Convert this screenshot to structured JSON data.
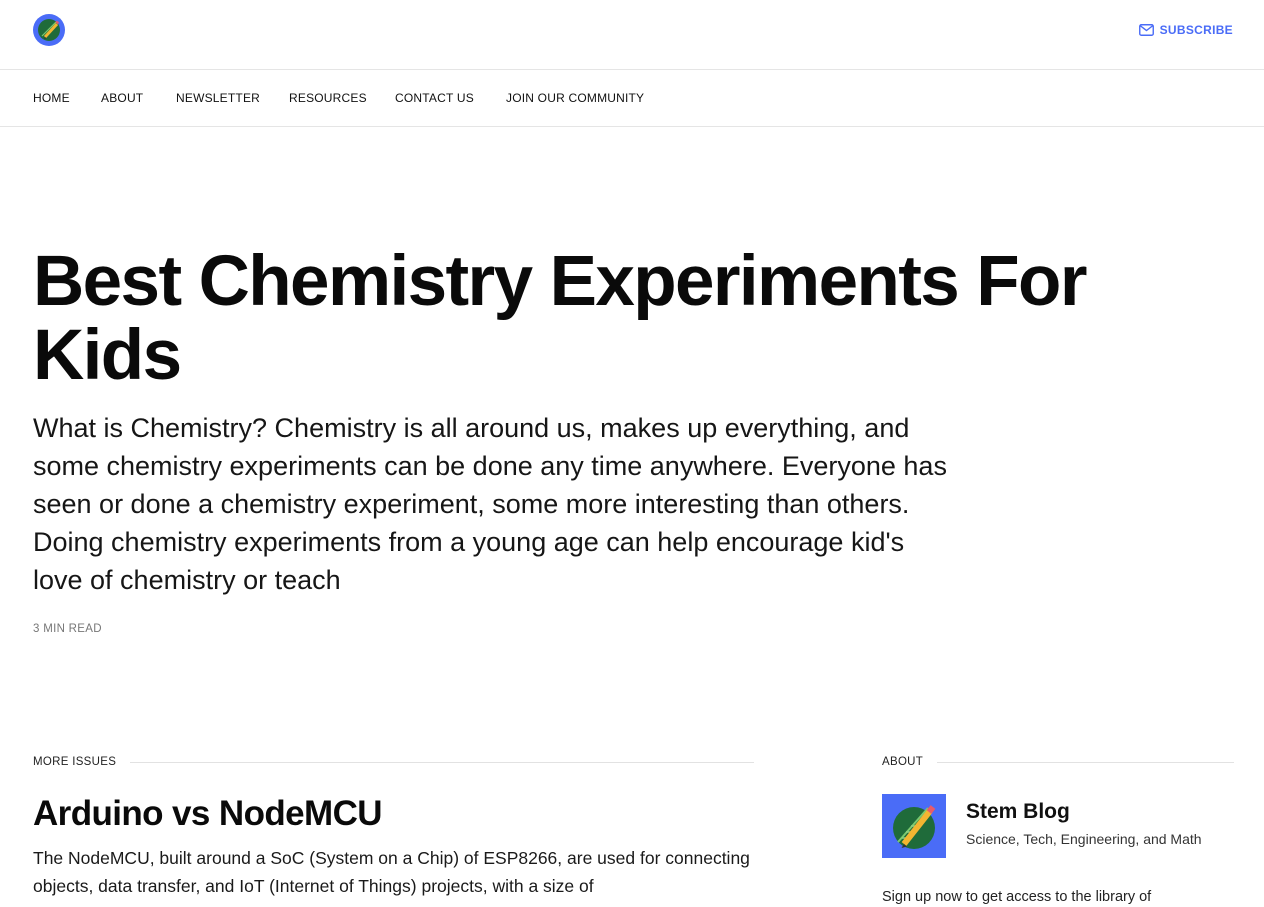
{
  "header": {
    "subscribe_label": "SUBSCRIBE"
  },
  "nav": {
    "items": [
      "HOME",
      "ABOUT",
      "NEWSLETTER",
      "RESOURCES",
      "CONTACT US",
      "JOIN OUR COMMUNITY"
    ]
  },
  "hero": {
    "title": "Best Chemistry Experiments For Kids",
    "excerpt": "What is Chemistry? Chemistry is all around us, makes up everything, and some chemistry experiments can be done any time anywhere. Everyone has seen or done a chemistry experiment, some more interesting than others. Doing chemistry experiments from a young age can help encourage kid's love of chemistry or teach",
    "read_time": "3 MIN READ"
  },
  "more_issues": {
    "heading": "MORE ISSUES",
    "title": "Arduino vs NodeMCU",
    "excerpt": "The NodeMCU, built around a SoC (System on a Chip) of ESP8266, are used for connecting objects, data transfer, and IoT (Internet of Things) projects, with a size of"
  },
  "about": {
    "heading": "ABOUT",
    "name": "Stem Blog",
    "description": "Science, Tech, Engineering, and Math",
    "signup_text": "Sign up now to get access to the library of"
  },
  "colors": {
    "accent": "#4a6cf7",
    "text": "#111111",
    "muted": "#777777",
    "rule": "#e5e5e5"
  },
  "icons": {
    "logo": "pencil-leaf-logo-icon",
    "subscribe": "mail-icon"
  }
}
